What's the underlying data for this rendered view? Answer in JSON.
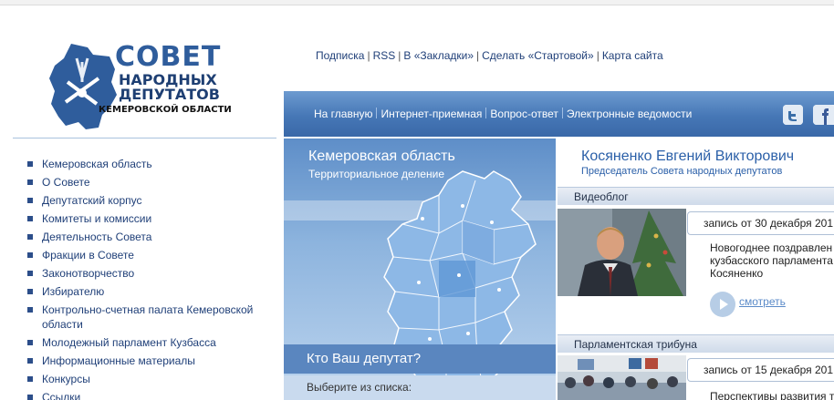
{
  "logo": {
    "line1": "СОВЕТ",
    "line2": "НАРОДНЫХ",
    "line3": "ДЕПУТАТОВ",
    "line4": "КЕМЕРОВСКОЙ ОБЛАСТИ"
  },
  "toplinks": [
    "Подписка",
    "RSS",
    "В «Закладки»",
    "Сделать «Стартовой»",
    "Карта сайта"
  ],
  "mainmenu": [
    "На главную",
    "Интернет-приемная",
    "Вопрос-ответ",
    "Электронные ведомости"
  ],
  "social": [
    "twitter-icon",
    "facebook-icon"
  ],
  "leftnav": [
    "Кемеровская область",
    "О Совете",
    "Депутатский корпус",
    "Комитеты и комиссии",
    "Деятельность Совета",
    "Фракции в Совете",
    "Законотворчество",
    "Избирателю",
    "Контрольно-счетная палата Кемеровской области",
    "Молодежный парламент Кузбасса",
    "Информационные материалы",
    "Конкурсы",
    "Ссылки"
  ],
  "map": {
    "title": "Кемеровская область",
    "subtitle": "Территориальное деление",
    "who": "Кто Ваш депутат?",
    "choose": "Выберите из списка:"
  },
  "chair": {
    "name": "Косяненко Евгений Викторович",
    "title": "Председатель Совета народных депутатов"
  },
  "videoblog": {
    "header": "Видеоблог",
    "date": "запись от 30 декабря 201",
    "desc": [
      "Новогоднее поздравлен",
      "кузбасского парламента",
      "Косяненко"
    ],
    "watch": "смотреть"
  },
  "tribune": {
    "header": "Парламентская трибуна",
    "date": "запись от 15 декабря 201",
    "desc": "Перспективы развития т"
  },
  "colors": {
    "brand_blue": "#2f5d9c",
    "bar_blue": "#4677b6",
    "link_blue": "#1f3f78"
  }
}
